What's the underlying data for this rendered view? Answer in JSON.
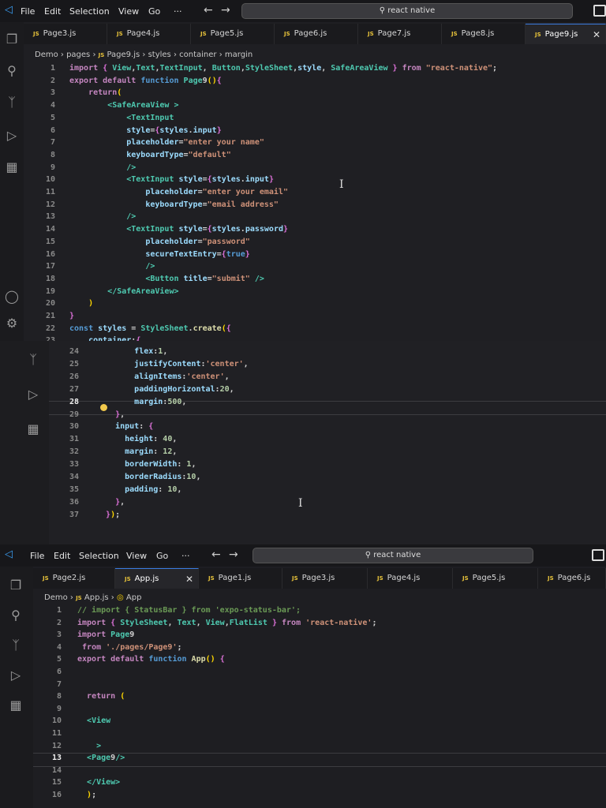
{
  "menu": [
    "File",
    "Edit",
    "Selection",
    "View",
    "Go",
    "···"
  ],
  "search_text": "react native",
  "panel1": {
    "tabs": [
      "Page3.js",
      "Page4.js",
      "Page5.js",
      "Page6.js",
      "Page7.js",
      "Page8.js",
      "Page9.js"
    ],
    "active_tab": "Page9.js",
    "breadcrumb": [
      "Demo",
      "pages",
      "Page9.js",
      "styles",
      "container",
      "margin"
    ],
    "lines": [
      {
        "n": "1",
        "t": "import { View,Text,TextInput, Button,StyleSheet,style, SafeAreaView } from \"react-native\";"
      },
      {
        "n": "2",
        "t": "export default function Page9(){"
      },
      {
        "n": "3",
        "t": "    return("
      },
      {
        "n": "4",
        "t": "        <SafeAreaView >"
      },
      {
        "n": "5",
        "t": "            <TextInput"
      },
      {
        "n": "6",
        "t": "            style={styles.input}"
      },
      {
        "n": "7",
        "t": "            placeholder=\"enter your name\""
      },
      {
        "n": "8",
        "t": "            keyboardType=\"default\""
      },
      {
        "n": "9",
        "t": "            />"
      },
      {
        "n": "10",
        "t": "            <TextInput style={styles.input}"
      },
      {
        "n": "11",
        "t": "                placeholder=\"enter your email\""
      },
      {
        "n": "12",
        "t": "                keyboardType=\"email address\""
      },
      {
        "n": "13",
        "t": "            />"
      },
      {
        "n": "14",
        "t": "            <TextInput style={styles.password}"
      },
      {
        "n": "15",
        "t": "                placeholder=\"password\""
      },
      {
        "n": "16",
        "t": "                secureTextEntry={true}"
      },
      {
        "n": "17",
        "t": "                />"
      },
      {
        "n": "18",
        "t": "                <Button title=\"submit\" />"
      },
      {
        "n": "19",
        "t": "        </SafeAreaView>"
      },
      {
        "n": "20",
        "t": "    )"
      },
      {
        "n": "21",
        "t": "}"
      },
      {
        "n": "22",
        "t": "const styles = StyleSheet.create({"
      },
      {
        "n": "23",
        "t": "    container:{"
      }
    ]
  },
  "panel2": {
    "current_line": "28",
    "lines": [
      {
        "n": "24",
        "t": "        flex:1,"
      },
      {
        "n": "25",
        "t": "        justifyContent:'center',"
      },
      {
        "n": "26",
        "t": "        alignItems:'center',"
      },
      {
        "n": "27",
        "t": "        paddingHorizontal:20,"
      },
      {
        "n": "28",
        "t": "        margin:500,"
      },
      {
        "n": "29",
        "t": "    },"
      },
      {
        "n": "30",
        "t": "    input: {"
      },
      {
        "n": "31",
        "t": "      height: 40,"
      },
      {
        "n": "32",
        "t": "      margin: 12,"
      },
      {
        "n": "33",
        "t": "      borderWidth: 1,"
      },
      {
        "n": "34",
        "t": "      borderRadius:10,"
      },
      {
        "n": "35",
        "t": "      padding: 10,"
      },
      {
        "n": "36",
        "t": "    },"
      },
      {
        "n": "37",
        "t": "  });"
      }
    ]
  },
  "panel3": {
    "tabs": [
      "Page2.js",
      "App.js",
      "Page1.js",
      "Page3.js",
      "Page4.js",
      "Page5.js",
      "Page6.js"
    ],
    "active_tab": "App.js",
    "breadcrumb": [
      "Demo",
      "App.js",
      "App"
    ],
    "current_line": "13",
    "lines": [
      {
        "n": "1",
        "t": "// import { StatusBar } from 'expo-status-bar';"
      },
      {
        "n": "2",
        "t": "import { StyleSheet, Text, View,FlatList } from 'react-native';"
      },
      {
        "n": "3",
        "t": "import Page9"
      },
      {
        "n": "4",
        "t": " from './pages/Page9';"
      },
      {
        "n": "5",
        "t": "export default function App() {"
      },
      {
        "n": "6",
        "t": ""
      },
      {
        "n": "7",
        "t": ""
      },
      {
        "n": "8",
        "t": "  return ("
      },
      {
        "n": "9",
        "t": ""
      },
      {
        "n": "10",
        "t": "  <View"
      },
      {
        "n": "11",
        "t": ""
      },
      {
        "n": "12",
        "t": "    >"
      },
      {
        "n": "13",
        "t": "  <Page9/>"
      },
      {
        "n": "14",
        "t": ""
      },
      {
        "n": "15",
        "t": "  </View>"
      },
      {
        "n": "16",
        "t": "  );"
      }
    ]
  }
}
